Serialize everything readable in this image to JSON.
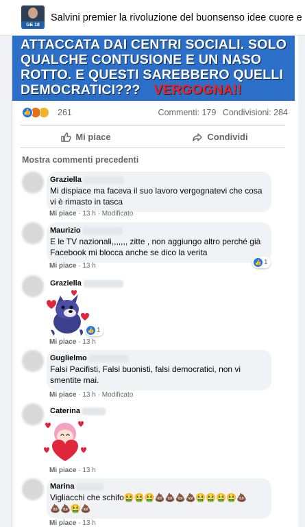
{
  "header": {
    "title": "Salvini premier la rivoluzione del buonsenso idee cuore e c",
    "avatar_badge": "GE 18"
  },
  "banner": {
    "line1": "ATTACCATA DAI CENTRI SOCIALI. SOLO",
    "line2": "QUALCHE CONTUSIONE E UN NASO",
    "line3": "ROTTO. E QUESTI SAREBBERO QUELLI",
    "line4_prefix": "DEMOCRATICI???",
    "line4_red": "VERGOGNA!!"
  },
  "stats": {
    "reaction_count": "261",
    "comments": "Commenti: 179",
    "shares": "Condivisioni: 284",
    "reaction_icons": [
      "like-icon",
      "angry-icon",
      "haha-icon"
    ]
  },
  "actions": {
    "like_label": "Mi piace",
    "share_label": "Condividi"
  },
  "more_comments": "Mostra commenti precedenti",
  "comments": [
    {
      "name": "Graziella",
      "text": "Mi dispiace ma faceva il suo lavoro vergognatevi che cosa vi è rimasto in tasca",
      "like": "Mi piace",
      "time": "13 h",
      "edited": "Modificato"
    },
    {
      "name": "Maurizio",
      "text": "E le TV nazionali,,,,,,, zitte , non aggiungo altro perché già Facebook mi blocca anche se dico la verita",
      "like": "Mi piace",
      "time": "13 h",
      "badge_count": "1"
    },
    {
      "name": "Graziella",
      "like": "Mi piace",
      "time": "13 h",
      "badge_count": "1"
    },
    {
      "name": "Guglielmo",
      "text": "Falsi Pacifisti, Falsi buonisti, falsi democratici, non vi smentite mai.",
      "like": "Mi piace",
      "time": "13 h",
      "edited": "Modificato"
    },
    {
      "name": "Caterina",
      "like": "Mi piace",
      "time": "13 h"
    },
    {
      "name": "Marina",
      "text_line1": "Vigliacchi che schifo🤮🤮🤮💩💩💩💩🤮🤮🤮🤮💩",
      "text_line2": "💩💩🤮💩",
      "like": "Mi piace",
      "time": "13 h"
    }
  ],
  "colors": {
    "banner_blue": "#2b6fc9",
    "brand_blue": "#1877f2",
    "red_text": "#e8232b",
    "muted": "#65676b"
  },
  "separator": "·"
}
